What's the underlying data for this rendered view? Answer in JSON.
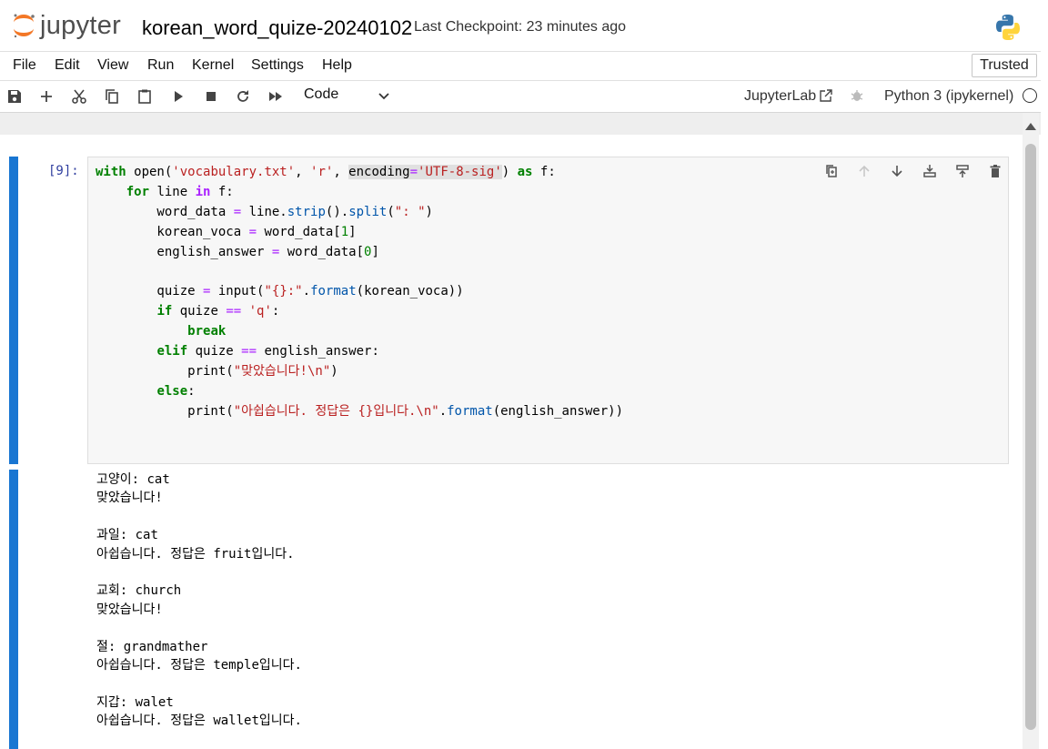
{
  "header": {
    "logo_text": "jupyter",
    "notebook_title": "korean_word_quize-20240102",
    "checkpoint": "Last Checkpoint: 23 minutes ago"
  },
  "menu": {
    "items": [
      "File",
      "Edit",
      "View",
      "Run",
      "Kernel",
      "Settings",
      "Help"
    ],
    "trusted": "Trusted"
  },
  "toolbar": {
    "icons": [
      "save-icon",
      "add-cell-icon",
      "cut-icon",
      "copy-icon",
      "paste-icon",
      "run-icon",
      "stop-icon",
      "restart-icon",
      "run-all-icon"
    ],
    "cell_type": "Code",
    "jupyterlab_label": "JupyterLab",
    "kernel_name": "Python 3 (ipykernel)"
  },
  "cell": {
    "prompt": "[9]:",
    "tools": [
      "duplicate-icon",
      "move-up-icon",
      "move-down-icon",
      "insert-above-icon",
      "insert-below-icon",
      "delete-icon"
    ],
    "code_lines": [
      "with open('vocabulary.txt', 'r', encoding='UTF-8-sig') as f:",
      "    for line in f:",
      "        word_data = line.strip().split(\": \")",
      "        korean_voca = word_data[1]",
      "        english_answer = word_data[0]",
      "",
      "        quize = input(\"{}:\".format(korean_voca))",
      "        if quize == 'q':",
      "            break",
      "        elif quize == english_answer:",
      "            print(\"맞았습니다!\\n\")",
      "        else:",
      "            print(\"아쉽습니다. 정답은 {}입니다.\\n\".format(english_answer))"
    ],
    "output_lines": [
      "고양이: cat",
      "맞았습니다!",
      "",
      "과일: cat",
      "아쉽습니다. 정답은 fruit입니다.",
      "",
      "교회: church",
      "맞았습니다!",
      "",
      "절: grandmather",
      "아쉽습니다. 정답은 temple입니다.",
      "",
      "지갑: walet",
      "아쉽습니다. 정답은 wallet입니다."
    ]
  },
  "colors": {
    "accent": "#1976d2",
    "keyword": "#008000",
    "string": "#ba2121",
    "operator": "#aa22ff",
    "prompt": "#303f9f"
  }
}
